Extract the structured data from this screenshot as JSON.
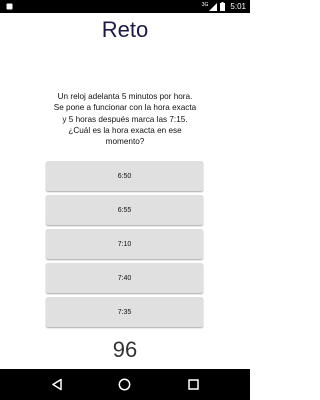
{
  "status_bar": {
    "network": "3G",
    "time": "5:01",
    "icons": [
      "notification-icon",
      "signal-icon",
      "battery-icon"
    ]
  },
  "screen": {
    "title": "Reto",
    "question": "Un reloj adelanta 5 minutos por hora.  Se pone a funcionar con la hora exacta y 5 horas después marca las 7:15.  ¿Cuál es la hora exacta en ese momento?",
    "options": [
      "6:50",
      "6:55",
      "7:10",
      "7:40",
      "7:35"
    ],
    "score": "96"
  },
  "nav_bar": {
    "icons": [
      "back-icon",
      "home-icon",
      "recents-icon"
    ]
  },
  "colors": {
    "title": "#1d1a4a",
    "option_bg": "#e0e0e0",
    "bars": "#000000"
  }
}
